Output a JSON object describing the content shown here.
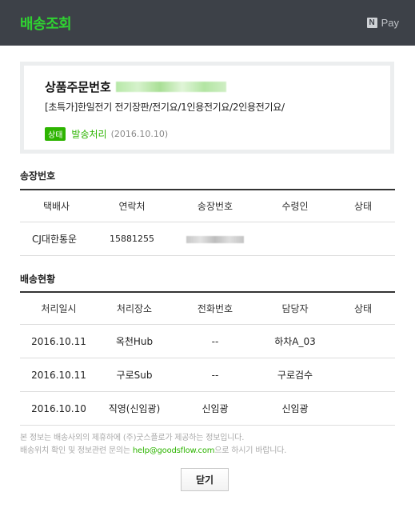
{
  "header": {
    "title": "배송조회",
    "pay_label": "Pay",
    "pay_logo": "N"
  },
  "order": {
    "title_label": "상품주문번호",
    "product_name": "[초특가]한일전기 전기장판/전기요/1인용전기요/2인용전기요/",
    "status_badge": "상태",
    "status": "발송처리",
    "status_date": "(2016.10.10)"
  },
  "invoice": {
    "section_title": "송장번호",
    "headers": [
      "택배사",
      "연락처",
      "송장번호",
      "수령인",
      "상태"
    ],
    "rows": [
      {
        "carrier": "CJ대한통운",
        "phone": "15881255",
        "tracking": "",
        "recipient": "",
        "status": ""
      }
    ]
  },
  "delivery": {
    "section_title": "배송현황",
    "headers": [
      "처리일시",
      "처리장소",
      "전화번호",
      "담당자",
      "상태"
    ],
    "rows": [
      {
        "date": "2016.10.11",
        "place": "옥천Hub",
        "phone": "--",
        "manager": "하차A_03",
        "status": ""
      },
      {
        "date": "2016.10.11",
        "place": "구로Sub",
        "phone": "--",
        "manager": "구로검수",
        "status": ""
      },
      {
        "date": "2016.10.10",
        "place": "직영(신임광)",
        "phone": "신임광",
        "manager": "신임광",
        "status": ""
      }
    ]
  },
  "notice": {
    "line1": "본 정보는 배송사외의 제휴하에 (주)굿스플로가 제공하는 정보입니다.",
    "line2_prefix": "배송위치 확인 및 정보관련 문의는 ",
    "email": "help@goodsflow.com",
    "line2_suffix": "으로 하시기 바랍니다."
  },
  "close_button": "닫기",
  "colors": {
    "header_bg": "#3d4148",
    "accent": "#2db400",
    "title_green": "#2fd331"
  }
}
